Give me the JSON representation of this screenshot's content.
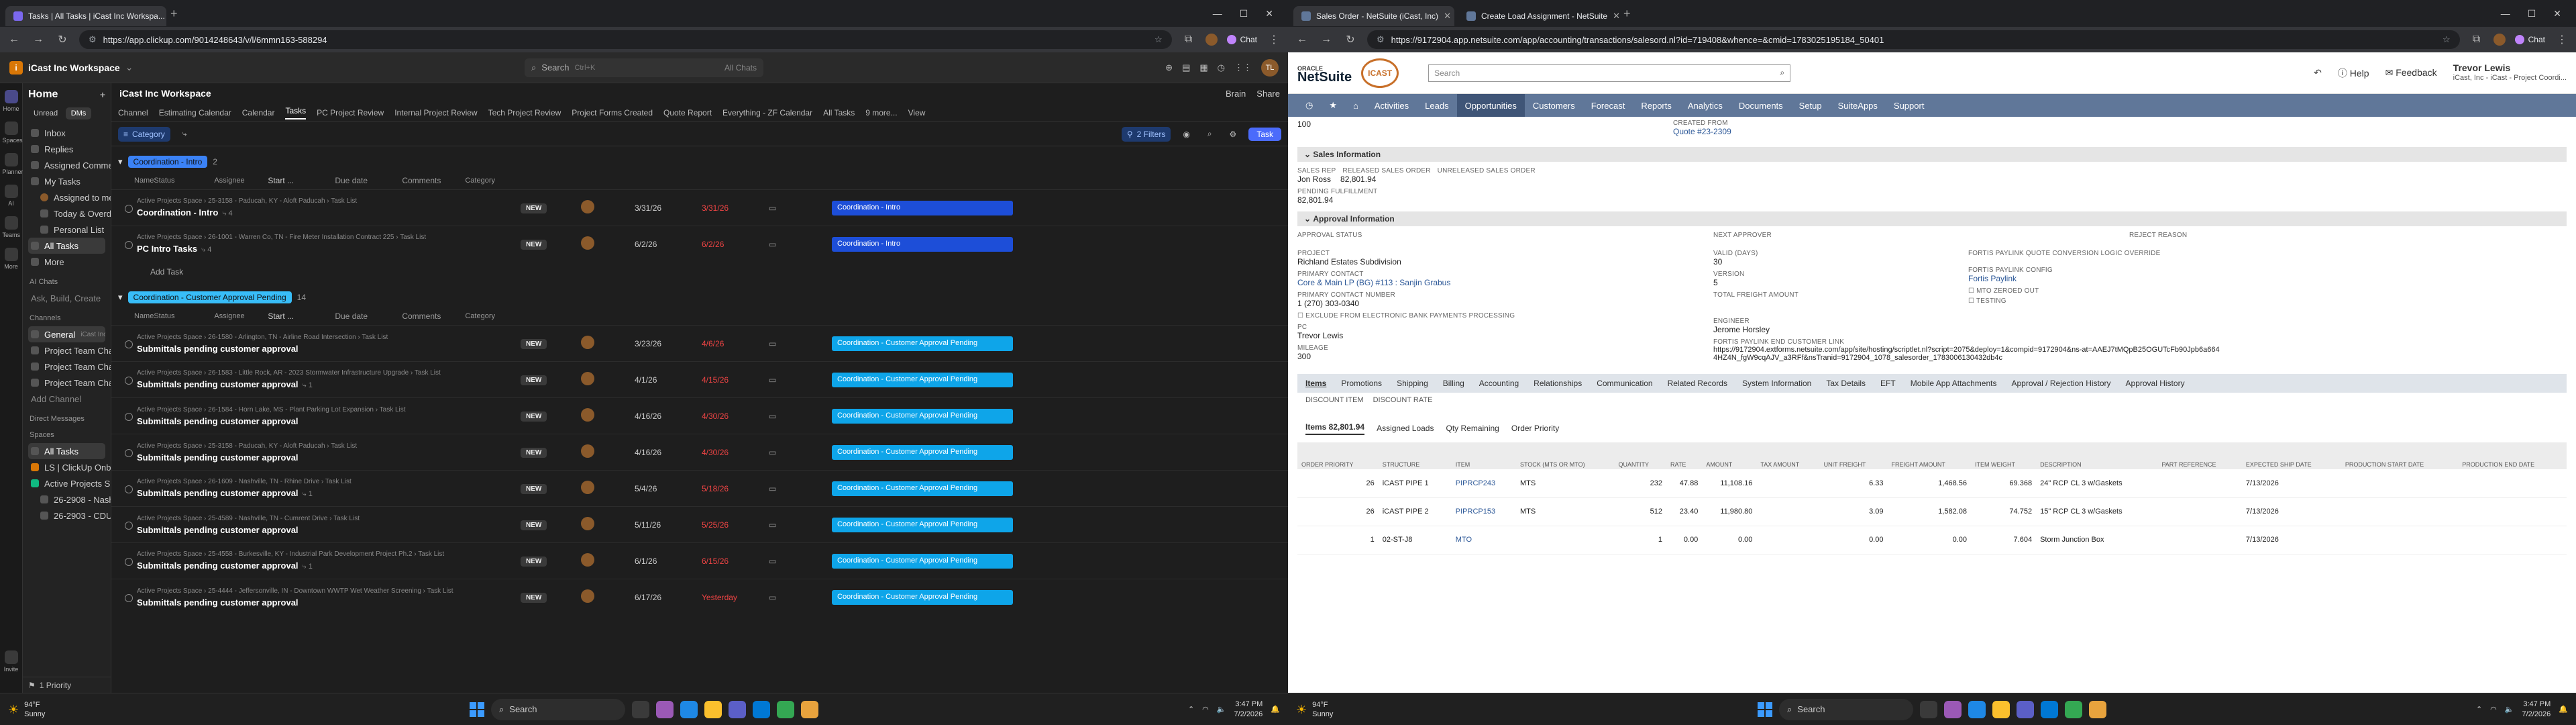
{
  "left": {
    "tabs": [
      {
        "title": "Tasks | All Tasks | iCast Inc Workspa...",
        "color": "#7b68ee"
      }
    ],
    "url": "https://app.clickup.com/9014248643/v/l/6mmn163-588294",
    "chat_label": "Chat",
    "workspace": {
      "logo": "i",
      "name": "iCast Inc Workspace"
    },
    "search": {
      "label": "Search",
      "shortcut": "Ctrl+K",
      "all_chats": "All Chats"
    },
    "rail": [
      "Home",
      "Spaces",
      "Planner",
      "AI",
      "Teams",
      "More",
      "Invite"
    ],
    "sidebar": {
      "title": "Home",
      "pills": [
        "Unread",
        "DMs"
      ],
      "items": [
        "Inbox",
        "Replies",
        "Assigned Comments",
        "My Tasks"
      ],
      "my_tasks": [
        "Assigned to me",
        "Today & Overdue",
        "Personal List"
      ],
      "today_count": "4",
      "all_tasks": "All Tasks",
      "more": "More",
      "ai_section": "AI Chats",
      "ai_item": "Ask, Build, Create",
      "channels_section": "Channels",
      "channels": [
        "General",
        "Project Team Chat",
        "Project Team Chat",
        "Project Team Chat"
      ],
      "general_ws": "iCast Inc Workspace",
      "add_channel": "Add Channel",
      "dm_section": "Direct Messages",
      "spaces_section": "Spaces",
      "spaces": [
        {
          "label": "All Tasks",
          "sub": "iCast Inc Workspace"
        },
        {
          "label": "LS | ClickUp Onboarding",
          "sub": ""
        },
        {
          "label": "Active Projects Space",
          "sub": ""
        },
        {
          "label": "26-2908 - Nashville, TN - N...",
          "sub": ""
        },
        {
          "label": "26-2903 - CDU - 187 12044...",
          "sub": ""
        }
      ],
      "footer": "1 Priority"
    },
    "main": {
      "title": "iCast Inc Workspace",
      "actions": [
        "Brain",
        "Share"
      ],
      "views": [
        "Channel",
        "Estimating Calendar",
        "Calendar",
        "Tasks",
        "PC Project Review",
        "Internal Project Review",
        "Tech Project Review",
        "Project Forms Created",
        "Quote Report",
        "Everything - ZF Calendar",
        "All Tasks",
        "9 more...",
        "View"
      ],
      "active_view": "Tasks",
      "filters": {
        "category": "Category",
        "filters": "2 Filters",
        "task": "Task"
      },
      "columns": [
        "Name",
        "Status",
        "Assignee",
        "Start ...",
        "Due date",
        "Comments",
        "Category"
      ],
      "groups": [
        {
          "name": "Coordination - Intro",
          "count": "2",
          "color": "#3b82f6",
          "tasks": [
            {
              "crumb": "Active Projects Space  ›  25-3158 - Paducah, KY - Aloft Paducah  ›  Task List",
              "name": "Coordination - Intro",
              "sub": "4",
              "status": "NEW",
              "start": "3/31/26",
              "due": "3/31/26",
              "due_color": "#ef4444",
              "category": "Coordination - Intro",
              "cat_color": "#1d4ed8"
            },
            {
              "crumb": "Active Projects Space  ›  26-1001 - Warren Co, TN - Fire Meter Installation Contract 225  ›  Task List",
              "name": "PC Intro Tasks",
              "sub": "4",
              "status": "NEW",
              "start": "6/2/26",
              "due": "6/2/26",
              "due_color": "#ef4444",
              "category": "Coordination - Intro",
              "cat_color": "#1d4ed8"
            }
          ],
          "add_task": "Add Task"
        },
        {
          "name": "Coordination - Customer Approval Pending",
          "count": "14",
          "color": "#38bdf8",
          "tasks": [
            {
              "crumb": "Active Projects Space  ›  26-1580 - Arlington, TN - Airline Road Intersection  ›  Task List",
              "name": "Submittals pending customer approval",
              "sub": "",
              "status": "NEW",
              "start": "3/23/26",
              "due": "4/6/26",
              "due_color": "#ef4444",
              "category": "Coordination - Customer Approval Pending",
              "cat_color": "#0ea5e9"
            },
            {
              "crumb": "Active Projects Space  ›  26-1583 - Little Rock, AR - 2023 Stormwater Infrastructure Upgrade  ›  Task List",
              "name": "Submittals pending customer approval",
              "sub": "1",
              "status": "NEW",
              "start": "4/1/26",
              "due": "4/15/26",
              "due_color": "#ef4444",
              "category": "Coordination - Customer Approval Pending",
              "cat_color": "#0ea5e9"
            },
            {
              "crumb": "Active Projects Space  ›  26-1584 - Horn Lake, MS - Plant Parking Lot Expansion  ›  Task List",
              "name": "Submittals pending customer approval",
              "sub": "",
              "status": "NEW",
              "start": "4/16/26",
              "due": "4/30/26",
              "due_color": "#ef4444",
              "category": "Coordination - Customer Approval Pending",
              "cat_color": "#0ea5e9"
            },
            {
              "crumb": "Active Projects Space  ›  25-3158 - Paducah, KY - Aloft Paducah  ›  Task List",
              "name": "Submittals pending customer approval",
              "sub": "",
              "status": "NEW",
              "start": "4/16/26",
              "due": "4/30/26",
              "due_color": "#ef4444",
              "category": "Coordination - Customer Approval Pending",
              "cat_color": "#0ea5e9"
            },
            {
              "crumb": "Active Projects Space  ›  26-1609 - Nashville, TN - Rhine Drive  ›  Task List",
              "name": "Submittals pending customer approval",
              "sub": "1",
              "status": "NEW",
              "start": "5/4/26",
              "due": "5/18/26",
              "due_color": "#ef4444",
              "category": "Coordination - Customer Approval Pending",
              "cat_color": "#0ea5e9"
            },
            {
              "crumb": "Active Projects Space  ›  25-4589 - Nashville, TN - Cumrent Drive  ›  Task List",
              "name": "Submittals pending customer approval",
              "sub": "",
              "status": "NEW",
              "start": "5/11/26",
              "due": "5/25/26",
              "due_color": "#ef4444",
              "category": "Coordination - Customer Approval Pending",
              "cat_color": "#0ea5e9"
            },
            {
              "crumb": "Active Projects Space  ›  25-4558 - Burkesville, KY - Industrial Park Development Project Ph.2  ›  Task List",
              "name": "Submittals pending customer approval",
              "sub": "1",
              "status": "NEW",
              "start": "6/1/26",
              "due": "6/15/26",
              "due_color": "#ef4444",
              "category": "Coordination - Customer Approval Pending",
              "cat_color": "#0ea5e9"
            },
            {
              "crumb": "Active Projects Space  ›  25-4444 - Jeffersonville, IN - Downtown WWTP Wet Weather Screening  ›  Task List",
              "name": "Submittals pending customer approval",
              "sub": "",
              "status": "NEW",
              "start": "6/17/26",
              "due": "Yesterday",
              "due_color": "#ef4444",
              "category": "Coordination - Customer Approval Pending",
              "cat_color": "#0ea5e9"
            }
          ]
        }
      ]
    },
    "taskbar": {
      "temp": "94°F",
      "weather": "Sunny",
      "search": "Search",
      "time": "3:47 PM",
      "date": "7/2/2026"
    }
  },
  "right": {
    "tabs": [
      {
        "title": "Sales Order - NetSuite (iCast, Inc)",
        "color": "#607799"
      },
      {
        "title": "Create Load Assignment - NetSuite",
        "color": "#607799"
      }
    ],
    "url": "https://9172904.app.netsuite.com/app/accounting/transactions/salesord.nl?id=719408&whence=&cmid=1783025195184_50401",
    "chat_label": "Chat",
    "header": {
      "oracle": "ORACLE",
      "netsuite": "NetSuite",
      "badge": "ICAST",
      "search_placeholder": "Search",
      "help": "Help",
      "feedback": "Feedback",
      "user_name": "Trevor Lewis",
      "user_role": "iCast, Inc - iCast - Project Coordi..."
    },
    "nav": [
      "Activities",
      "Leads",
      "Opportunities",
      "Customers",
      "Forecast",
      "Reports",
      "Analytics",
      "Documents",
      "Setup",
      "SuiteApps",
      "Support"
    ],
    "active_nav": "Opportunities",
    "top_fields": {
      "probability": "100",
      "created_from_label": "CREATED FROM",
      "created_from": "Quote #23-2309"
    },
    "sales_info": {
      "title": "Sales Information",
      "labels": [
        "SALES REP",
        "RELEASED SALES ORDER",
        "UNRELEASED SALES ORDER"
      ],
      "rep": "Jon Ross",
      "released": "82,801.94",
      "pending_label": "PENDING FULFILLMENT",
      "pending": "82,801.94"
    },
    "approval": {
      "title": "Approval Information",
      "cols": [
        "APPROVAL STATUS",
        "NEXT APPROVER",
        "REJECT REASON"
      ]
    },
    "details": {
      "project_label": "PROJECT",
      "project": "Richland Estates Subdivision",
      "contact_label": "PRIMARY CONTACT",
      "contact": "Core & Main LP (BG) #113 : Sanjin Grabus",
      "contact_num_label": "PRIMARY CONTACT NUMBER",
      "contact_num": "1 (270) 303-0340",
      "exclude_label": "EXCLUDE FROM ELECTRONIC BANK PAYMENTS PROCESSING",
      "pc_label": "PC",
      "pc": "Trevor Lewis",
      "mileage_label": "MILEAGE",
      "mileage": "300",
      "valid_label": "VALID (DAYS)",
      "valid": "30",
      "version_label": "VERSION",
      "version": "5",
      "freight_label": "TOTAL FREIGHT AMOUNT",
      "engineer_label": "ENGINEER",
      "engineer": "Jerome Horsley",
      "fortis_link_label": "FORTIS PAYLINK END CUSTOMER LINK",
      "fortis_link": "https://9172904.extforms.netsuite.com/app/site/hosting/scriptlet.nl?script=2075&deploy=1&compid=9172904&ns-at=AAEJ7tMQpB25OGUTcFb90Jpb6a6644HZ4N_fgW9cqAJV_a3RFf&nsTranid=9172904_1078_salesorder_1783006130432db4c",
      "override_label": "FORTIS PAYLINK QUOTE CONVERSION LOGIC OVERRIDE",
      "config_label": "FORTIS PAYLINK CONFIG",
      "config": "Fortis Paylink",
      "mto_label": "MTO ZEROED OUT",
      "testing_label": "TESTING"
    },
    "subtabs": [
      "Items",
      "Promotions",
      "Shipping",
      "Billing",
      "Accounting",
      "Relationships",
      "Communication",
      "Related Records",
      "System Information",
      "Tax Details",
      "EFT",
      "Mobile App Attachments",
      "Approval / Rejection History",
      "Approval History"
    ],
    "discount_labels": [
      "DISCOUNT ITEM",
      "DISCOUNT RATE"
    ],
    "item_tabs": [
      "Items 82,801.94",
      "Assigned Loads",
      "Qty Remaining",
      "Order Priority"
    ],
    "item_columns": [
      "ORDER PRIORITY",
      "STRUCTURE",
      "ITEM",
      "STOCK (MTS OR MTO)",
      "QUANTITY",
      "RATE",
      "AMOUNT",
      "TAX AMOUNT",
      "UNIT FREIGHT",
      "FREIGHT AMOUNT",
      "ITEM WEIGHT",
      "DESCRIPTION",
      "PART REFERENCE",
      "EXPECTED SHIP DATE",
      "PRODUCTION START DATE",
      "PRODUCTION END DATE"
    ],
    "items": [
      {
        "priority": "26",
        "structure": "iCAST PIPE 1",
        "item": "PIPRCP243",
        "stock": "MTS",
        "qty": "232",
        "rate": "47.88",
        "amount": "11,108.16",
        "tax": "",
        "unit_freight": "6.33",
        "freight": "1,468.56",
        "weight": "69.368",
        "desc": "24\" RCP CL 3 w/Gaskets",
        "part": "",
        "ship": "7/13/2026",
        "pstart": "",
        "pend": ""
      },
      {
        "priority": "26",
        "structure": "iCAST PIPE 2",
        "item": "PIPRCP153",
        "stock": "MTS",
        "qty": "512",
        "rate": "23.40",
        "amount": "11,980.80",
        "tax": "",
        "unit_freight": "3.09",
        "freight": "1,582.08",
        "weight": "74.752",
        "desc": "15\" RCP CL 3 w/Gaskets",
        "part": "",
        "ship": "7/13/2026",
        "pstart": "",
        "pend": ""
      },
      {
        "priority": "1",
        "structure": "02-ST-J8",
        "item": "MTO",
        "stock": "",
        "qty": "1",
        "rate": "0.00",
        "amount": "0.00",
        "tax": "",
        "unit_freight": "0.00",
        "freight": "0.00",
        "weight": "7.604",
        "desc": "Storm Junction Box",
        "part": "",
        "ship": "7/13/2026",
        "pstart": "",
        "pend": ""
      }
    ],
    "taskbar": {
      "temp": "94°F",
      "weather": "Sunny",
      "search": "Search",
      "time": "3:47 PM",
      "date": "7/2/2026"
    }
  }
}
